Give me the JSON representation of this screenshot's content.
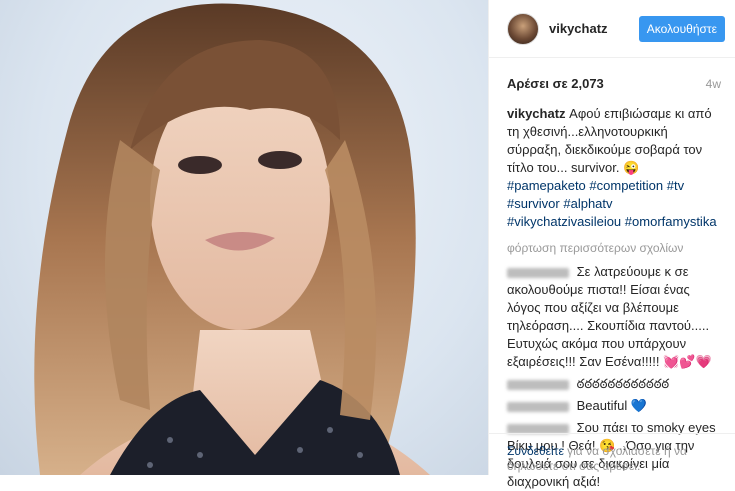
{
  "post": {
    "username": "vikychatz",
    "follow_label": "Ακολουθήστε",
    "likes": "Αρέσει σε 2,073",
    "age": "4w"
  },
  "caption": {
    "username": "vikychatz",
    "text": "Αφού επιβιώσαμε κι από τη χθεσινή...ελληνοτουρκική σύρραξη, διεκδικούμε σοβαρά τον τίτλο του... survivor. 😜",
    "hashtags": [
      "#pamepaketo",
      "#competition",
      "#tv",
      "#survivor",
      "#alphatv",
      "#vikychatzivasileiou",
      "#omorfamystika"
    ]
  },
  "load_more": "φόρτωση περισσότερων σχολίων",
  "comments": [
    {
      "text": "Σε λατρεύουμε κ σε ακολουθούμε πιστα!! Είσαι ένας λόγος που αξίζει να βλέπουμε τηλεόραση.... Σκουπίδια παντού..... Ευτυχώς ακόμα που υπάρχουν εξαιρέσεις!!! Σαν Εσένα!!!!!",
      "emoji": "💓💕💗"
    },
    {
      "text": "ఠఠఠఠఠఠఠఠఠఠఠఠ",
      "emoji": ""
    },
    {
      "text": "Beautiful",
      "emoji": "💙"
    },
    {
      "text": "Σου πάει το smoky eyes Βίκυ μου ! Θεά! 😘 ..Όσο για την δουλειά σου σε διακρίνει μία διαχρονική αξιά!",
      "emoji": ""
    }
  ],
  "footer": {
    "login_link": "Συνδεθείτε",
    "login_text": "για να σχολιάσετε ή να δηλώσετε ότι σας αρέσει."
  },
  "colors": {
    "accent": "#3897f0",
    "link": "#003569",
    "muted": "#999999"
  }
}
